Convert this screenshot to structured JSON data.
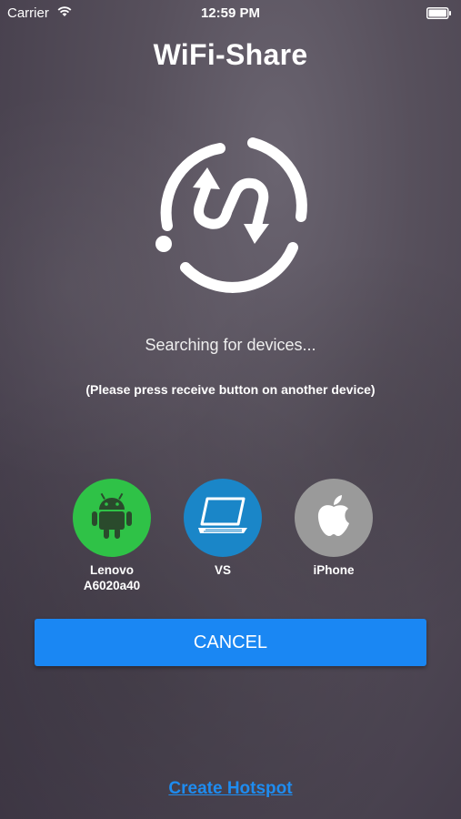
{
  "status_bar": {
    "carrier": "Carrier",
    "time": "12:59 PM",
    "icons": [
      "wifi-icon",
      "battery-icon"
    ]
  },
  "app": {
    "title": "WiFi-Share"
  },
  "search": {
    "status": "Searching for devices...",
    "hint": "(Please press receive button on another device)"
  },
  "devices": [
    {
      "name_line1": "Lenovo",
      "name_line2": "A6020a40",
      "icon": "android-icon",
      "color": "#2fc247"
    },
    {
      "name_line1": "VS",
      "name_line2": "",
      "icon": "laptop-icon",
      "color": "#1a86c8"
    },
    {
      "name_line1": "iPhone",
      "name_line2": "",
      "icon": "apple-icon",
      "color": "#9a9a9a"
    }
  ],
  "actions": {
    "cancel_label": "CANCEL",
    "hotspot_label": "Create Hotspot"
  },
  "colors": {
    "accent": "#1a87f3",
    "link": "#1e8cf0"
  }
}
